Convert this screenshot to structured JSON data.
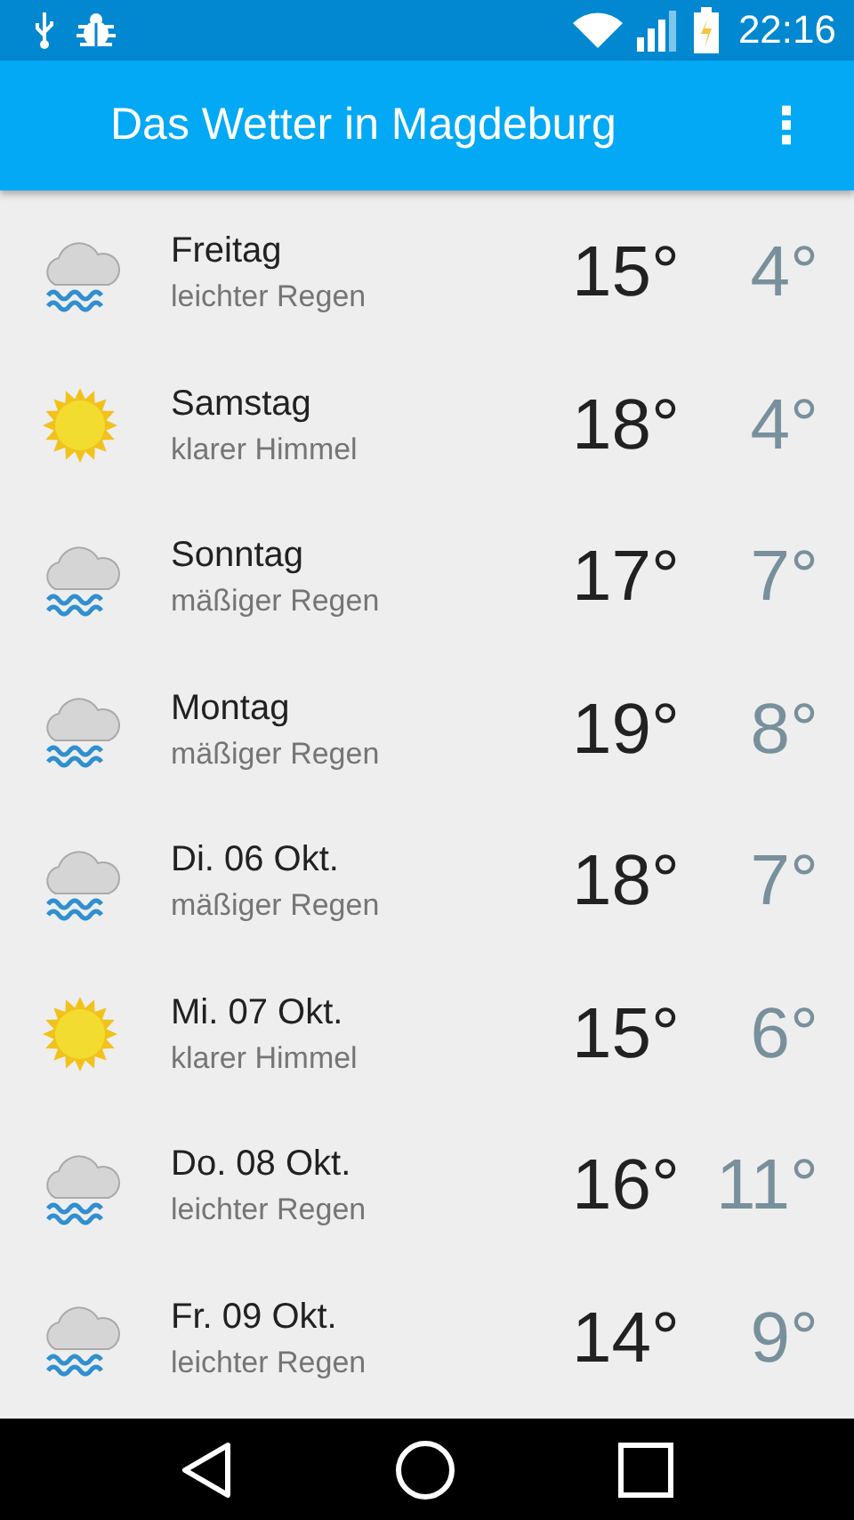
{
  "status_bar": {
    "time": "22:16"
  },
  "app_bar": {
    "title": "Das Wetter in Magdeburg",
    "menu": "⋮"
  },
  "forecast": [
    {
      "kind": "rain",
      "day": "Freitag",
      "description": "leichter Regen",
      "high": "15°",
      "low": "4°"
    },
    {
      "kind": "sun",
      "day": "Samstag",
      "description": "klarer Himmel",
      "high": "18°",
      "low": "4°"
    },
    {
      "kind": "rain",
      "day": "Sonntag",
      "description": "mäßiger Regen",
      "high": "17°",
      "low": "7°"
    },
    {
      "kind": "rain",
      "day": "Montag",
      "description": "mäßiger Regen",
      "high": "19°",
      "low": "8°"
    },
    {
      "kind": "rain",
      "day": "Di. 06 Okt.",
      "description": "mäßiger Regen",
      "high": "18°",
      "low": "7°"
    },
    {
      "kind": "sun",
      "day": "Mi. 07 Okt.",
      "description": "klarer Himmel",
      "high": "15°",
      "low": "6°"
    },
    {
      "kind": "rain",
      "day": "Do. 08 Okt.",
      "description": "leichter Regen",
      "high": "16°",
      "low": "11°"
    },
    {
      "kind": "rain",
      "day": "Fr. 09 Okt.",
      "description": "leichter Regen",
      "high": "14°",
      "low": "9°"
    }
  ]
}
